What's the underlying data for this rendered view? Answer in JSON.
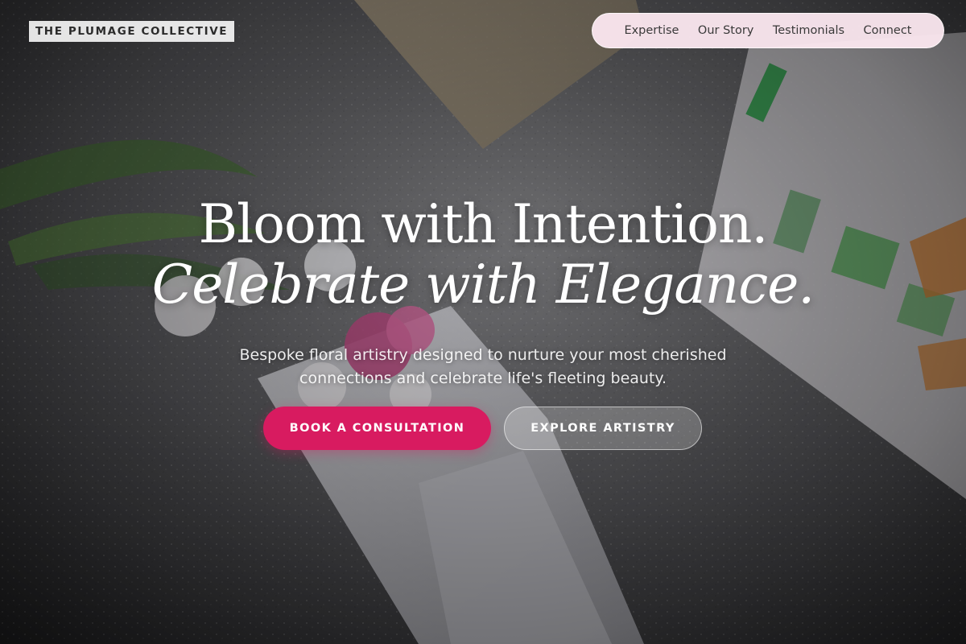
{
  "brand": {
    "logo_text": "THE PLUMAGE COLLECTIVE"
  },
  "nav": {
    "items": [
      "Expertise",
      "Our Story",
      "Testimonials",
      "Connect"
    ]
  },
  "hero": {
    "headline_line1": "Bloom with Intention.",
    "headline_line2": "Celebrate with Elegance.",
    "subtitle": "Bespoke floral artistry designed to nurture your most cherished connections and celebrate life's fleeting beauty.",
    "primary_cta": "BOOK A CONSULTATION",
    "secondary_cta": "EXPLORE ARTISTRY"
  },
  "colors": {
    "accent": "#d81b60",
    "nav_background": "#fce8f0",
    "text_light": "#ffffff"
  }
}
